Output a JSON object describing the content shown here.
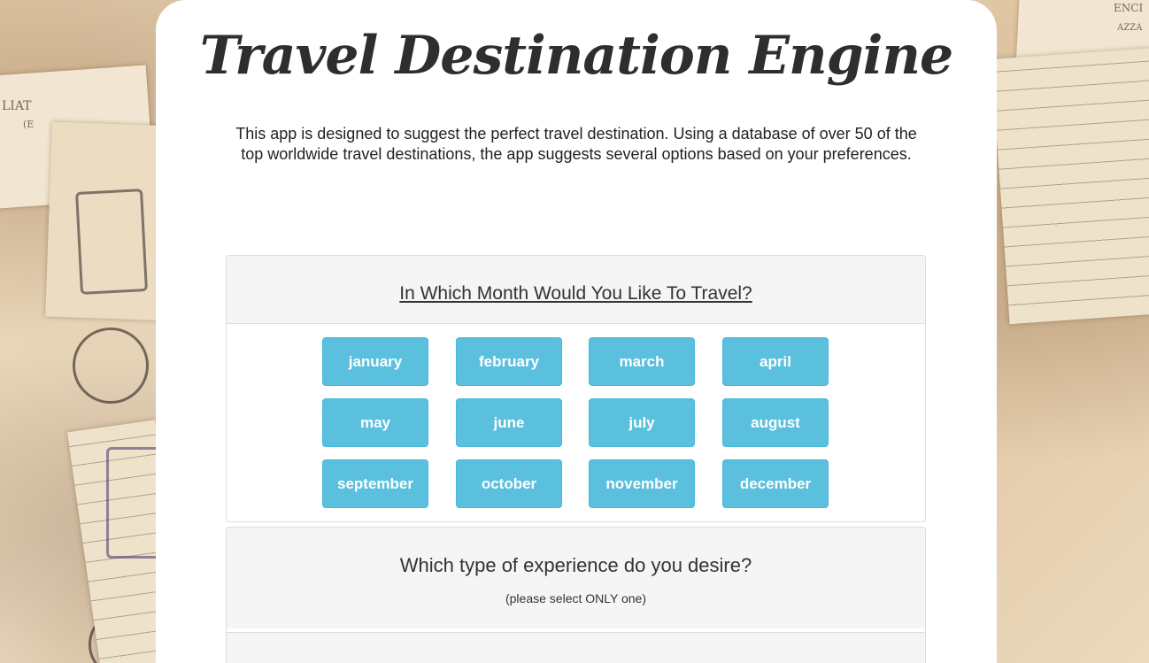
{
  "header": {
    "title": "Travel Destination Engine",
    "intro": "This app is designed to suggest the perfect travel destination. Using a database of over 50 of the top worldwide travel destinations, the app suggests several options based on your preferences."
  },
  "month_panel": {
    "heading": "In Which Month Would You Like To Travel?",
    "months": [
      "january",
      "february",
      "march",
      "april",
      "may",
      "june",
      "july",
      "august",
      "september",
      "october",
      "november",
      "december"
    ]
  },
  "experience_panel": {
    "heading": "Which type of experience do you desire?",
    "subheading": "(please select ONLY one)"
  },
  "background_text": {
    "left_1": "LIAT",
    "left_2": "(E",
    "right_1": "ENCI",
    "right_2": "AZZA"
  },
  "colors": {
    "button_bg": "#5bc0de",
    "button_border": "#46b8da",
    "panel_head_bg": "#f5f5f5",
    "card_bg": "#ffffff"
  }
}
